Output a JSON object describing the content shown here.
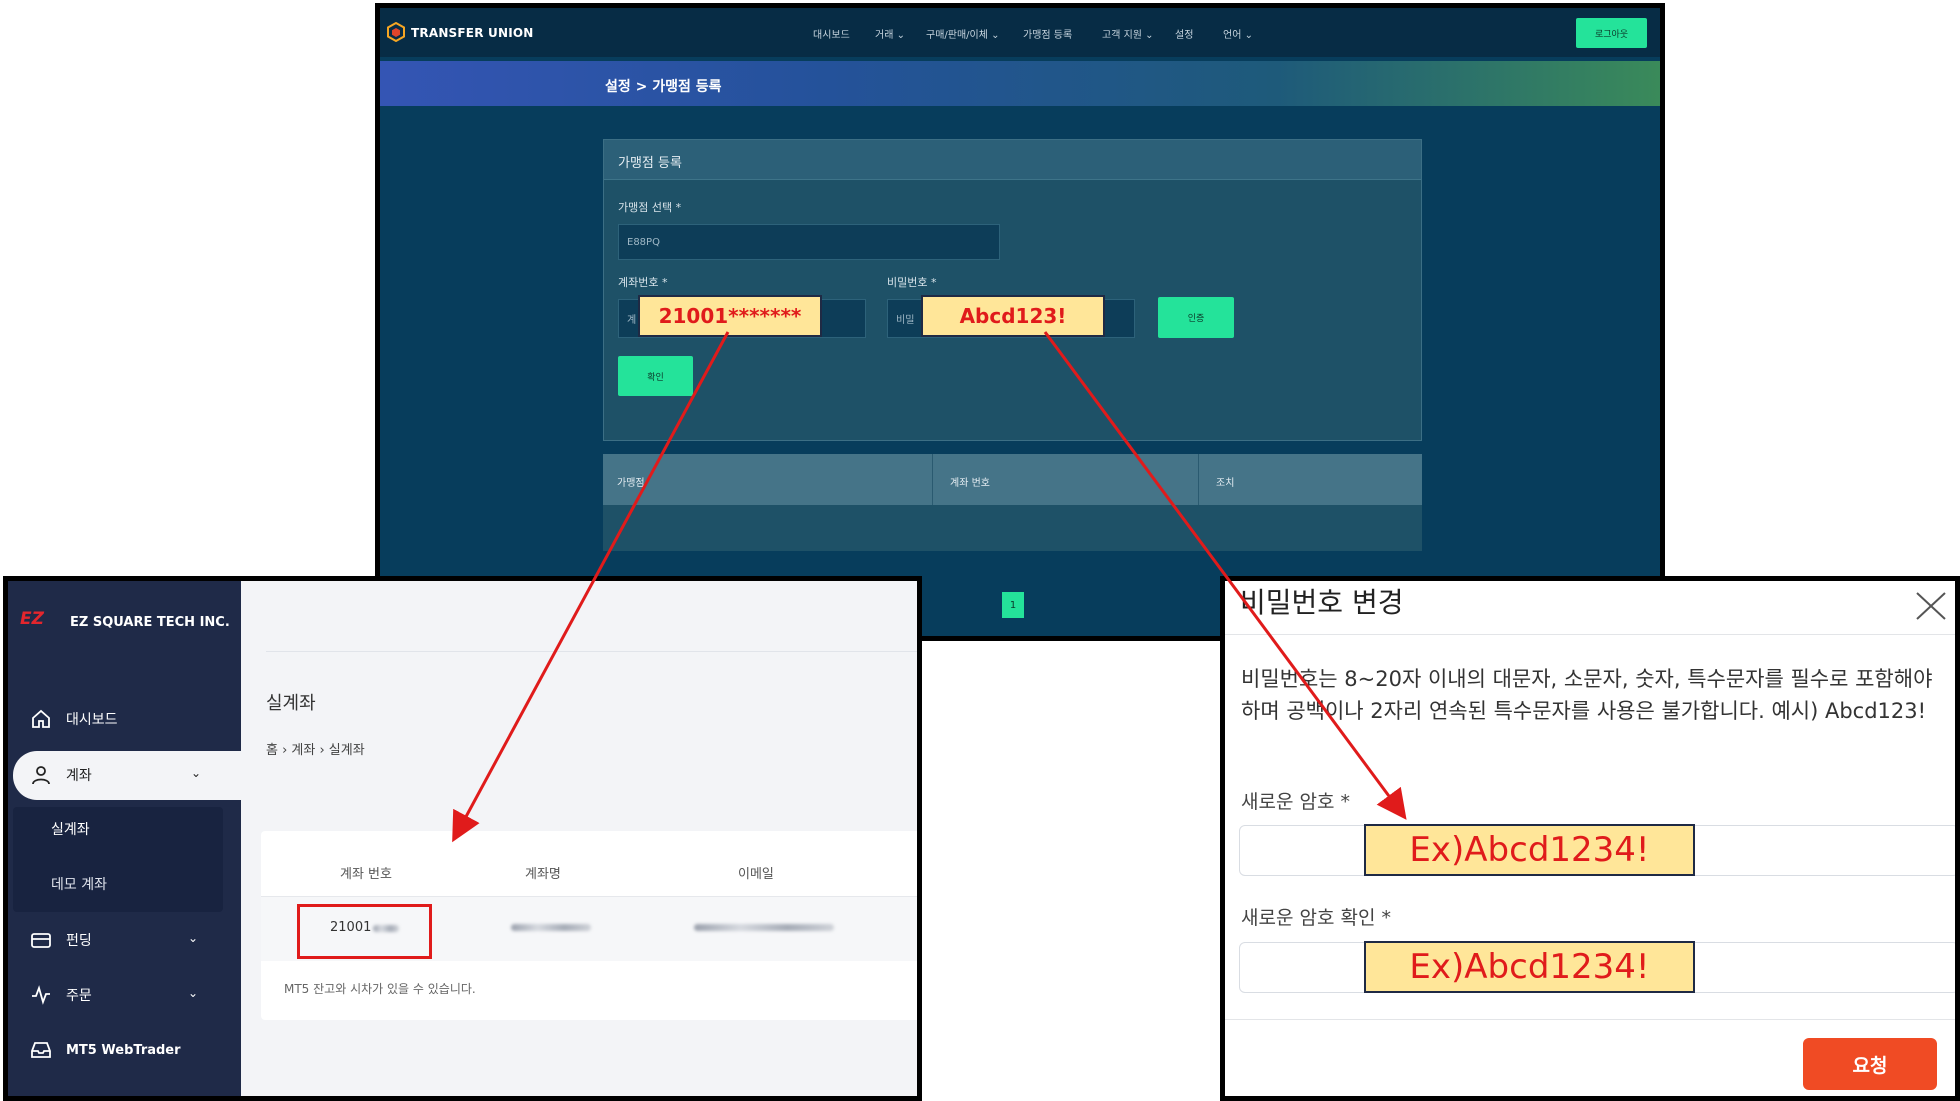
{
  "transfer_union": {
    "brand": "TRANSFER UNION",
    "nav": [
      "대시보드",
      "거래 ⌄",
      "구매/판매/이체 ⌄",
      "가맹점 등록",
      "고객 지원 ⌄",
      "설정",
      "언어 ⌄"
    ],
    "logout_label": "로그아웃",
    "breadcrumb": "설정 > 가맹점 등록",
    "card_title": "가맹점 등록",
    "merchant_select_label": "가맹점 선택 *",
    "merchant_select_value": "E88PQ",
    "account_label": "계좌번호 *",
    "account_placeholder": "계",
    "password_label": "비밀번호 *",
    "password_placeholder": "비밀",
    "verify_label": "인증",
    "confirm_label": "확인",
    "table_headers": [
      "가맹점",
      "계좌 번호",
      "조치"
    ],
    "page_number": "1",
    "callout_account": "21001*******",
    "callout_password": "Abcd123!"
  },
  "ez_square": {
    "brand": "EZ SQUARE TECH INC.",
    "logo_text": "EZ",
    "menu": {
      "dashboard": "대시보드",
      "account": "계좌",
      "real_account": "실계좌",
      "demo_account": "데모 계좌",
      "funding": "펀딩",
      "orders": "주문",
      "webtrader": "MT5 WebTrader"
    },
    "page_title": "실계좌",
    "breadcrumb": "홈  ›  계좌  ›  실계좌",
    "table_headers": [
      "계좌 번호",
      "계좌명",
      "이메일"
    ],
    "account_number": "21001",
    "footnote": "MT5 잔고와 시차가 있을 수 있습니다."
  },
  "password_modal": {
    "title": "비밀번호 변경",
    "description": "비밀번호는 8~20자 이내의 대문자, 소문자, 숫자, 특수문자를 필수로 포함해야 하며 공백이나 2자리 연속된 특수문자를 사용은 불가합니다. 예시) Abcd123!",
    "new_password_label": "새로운 암호 *",
    "confirm_password_label": "새로운 암호 확인 *",
    "example_value": "Ex)Abcd1234!",
    "request_label": "요청"
  },
  "colors": {
    "tu_bg": "#073d5c",
    "tu_accent": "#24e39a",
    "ez_sidebar": "#1f2a48",
    "callout_fill": "#ffe699",
    "callout_text": "#e01b1b",
    "arrow": "#e01b1b",
    "request_button": "#f04b24"
  }
}
